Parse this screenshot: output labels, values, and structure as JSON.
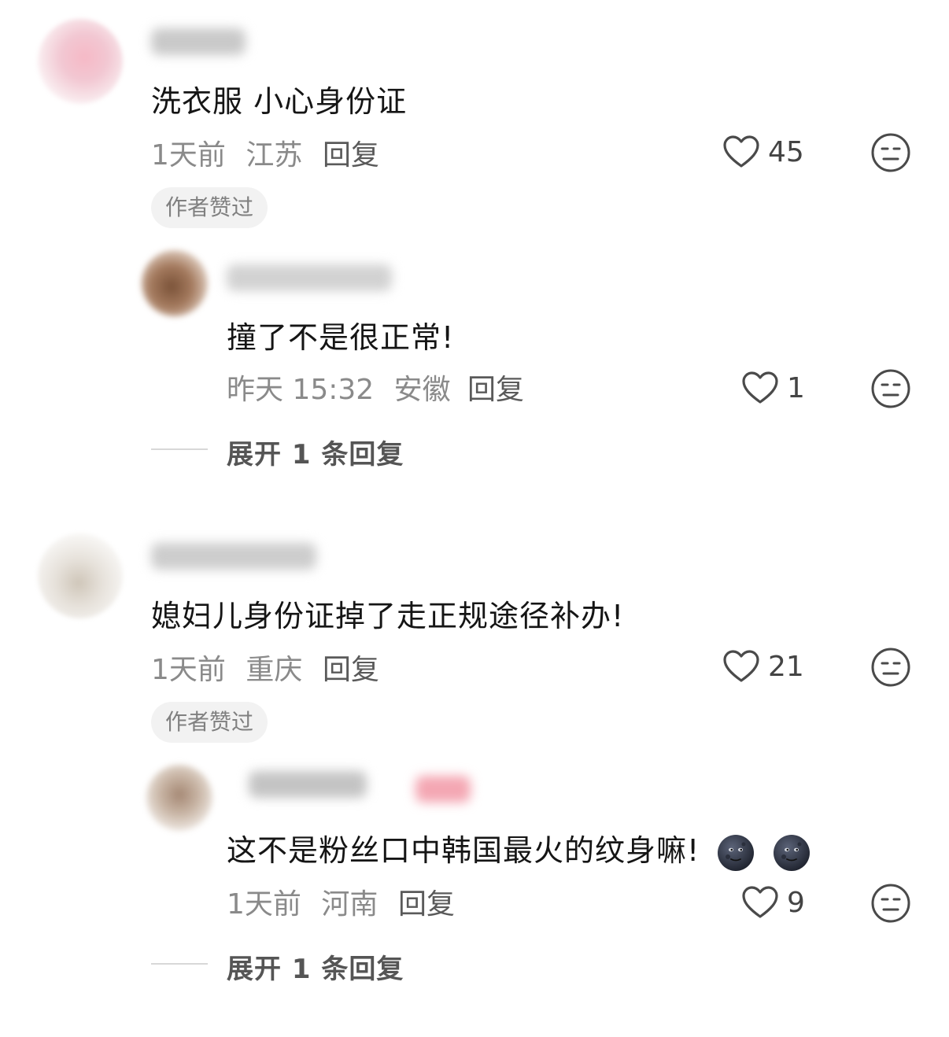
{
  "comments": [
    {
      "text": "洗衣服 小心身份证",
      "time": "1天前",
      "location": "江苏",
      "reply_label": "回复",
      "likes": "45",
      "badge": "作者赞过",
      "reply": {
        "text": "撞了不是很正常!",
        "time": "昨天 15:32",
        "location": "安徽",
        "reply_label": "回复",
        "likes": "1"
      },
      "expand_label": "展开 1 条回复"
    },
    {
      "text": "媳妇儿身份证掉了走正规途径补办!",
      "time": "1天前",
      "location": "重庆",
      "reply_label": "回复",
      "likes": "21",
      "badge": "作者赞过",
      "reply": {
        "text": "这不是粉丝口中韩国最火的纹身嘛!",
        "emoji": [
          "new-moon-face",
          "new-moon-face"
        ],
        "time": "1天前",
        "location": "河南",
        "reply_label": "回复",
        "likes": "9"
      },
      "expand_label": "展开 1 条回复"
    }
  ],
  "icons": {
    "like": "heart-outline-icon",
    "dislike": "unamused-face-icon"
  },
  "colors": {
    "text_primary": "#151515",
    "text_meta": "#8a8a8a",
    "badge_bg": "#f2f2f2"
  }
}
